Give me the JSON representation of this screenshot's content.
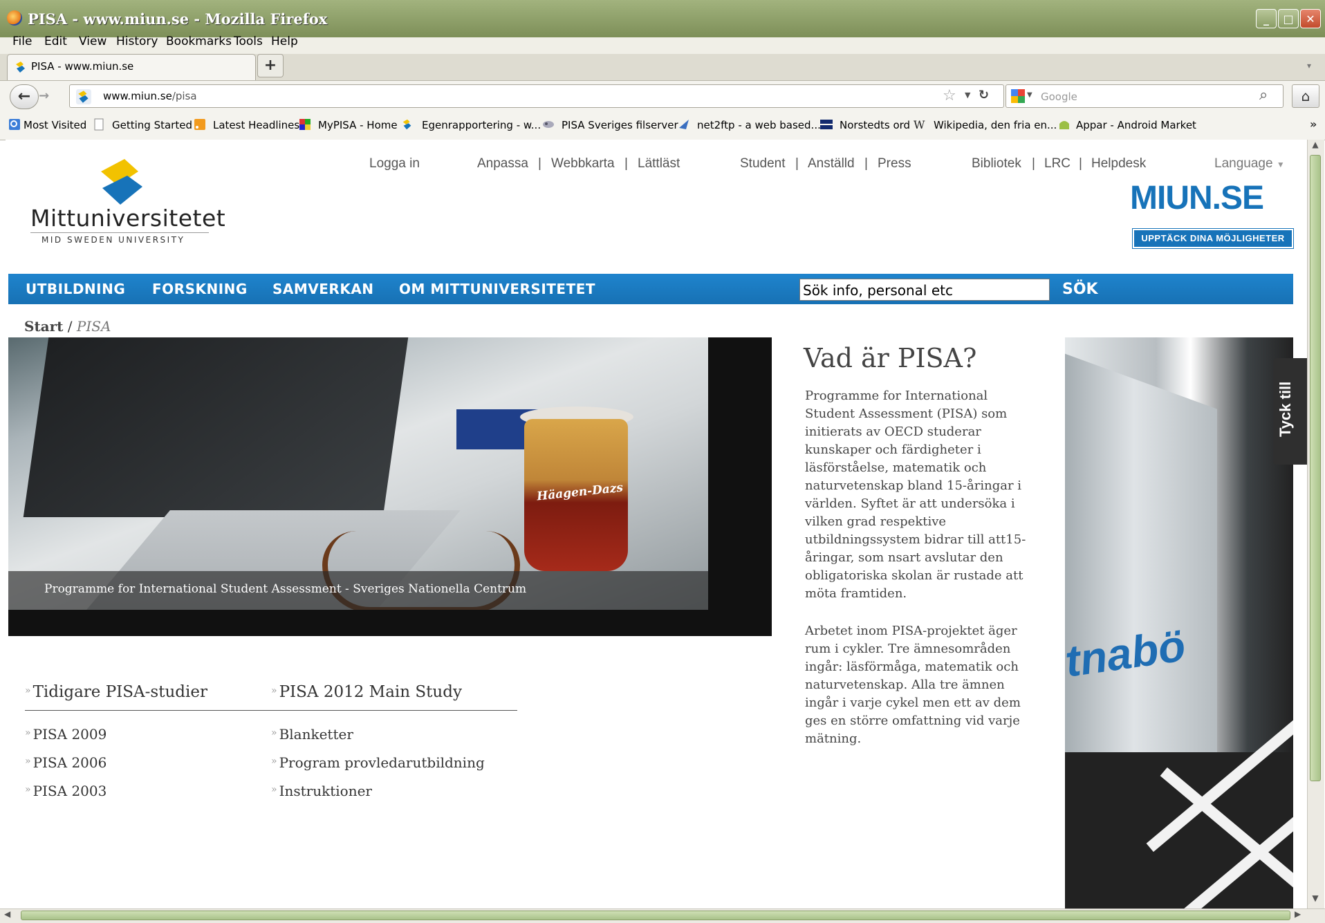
{
  "window": {
    "title": "PISA - www.miun.se - Mozilla Firefox",
    "minimize": "_",
    "maximize": "□",
    "close": "✕"
  },
  "menu": [
    "File",
    "Edit",
    "View",
    "History",
    "Bookmarks",
    "Tools",
    "Help"
  ],
  "tab": {
    "label": "PISA - www.miun.se",
    "new_tab": "+"
  },
  "url": {
    "host": "www.miun.se",
    "path": "/pisa"
  },
  "search": {
    "placeholder": "Google"
  },
  "bookmarks": [
    "Most Visited",
    "Getting Started",
    "Latest Headlines",
    "MyPISA - Home",
    "Egenrapportering - w...",
    "PISA Sveriges filserver",
    "net2ftp - a web based...",
    "Norstedts ord",
    "Wikipedia, den fria en...",
    "Appar - Android Market"
  ],
  "toplinks": {
    "login": "Logga in",
    "group1": [
      "Anpassa",
      "Webbkarta",
      "Lättläst"
    ],
    "group2": [
      "Student",
      "Anställd",
      "Press"
    ],
    "group3": [
      "Bibliotek",
      "LRC",
      "Helpdesk"
    ],
    "language": "Language"
  },
  "logo": {
    "name": "Mittuniversitetet",
    "sub": "MID SWEDEN UNIVERSITY"
  },
  "miun": {
    "title": "MIUN.SE",
    "tagline": "UPPTÄCK DINA MÖJLIGHETER"
  },
  "nav": [
    "UTBILDNING",
    "FORSKNING",
    "SAMVERKAN",
    "OM MITTUNIVERSITETET"
  ],
  "site_search": {
    "placeholder": "Sök info, personal etc",
    "button": "SÖK"
  },
  "breadcrumb": {
    "start": "Start",
    "sep": "/",
    "current": "PISA"
  },
  "hero": {
    "caption": "Programme for International Student Assessment - Sveriges Nationella Centrum",
    "cup_brand": "Häagen-Dazs"
  },
  "about": {
    "title": "Vad är PISA?",
    "p1": "Programme for International Student Assessment (PISA) som initierats av OECD studerar kunskaper och färdigheter i läsförståelse, matematik och naturvetenskap bland 15-åringar i världen. Syftet är att undersöka i vilken grad respektive utbildningssystem bidrar till att15-åringar, som nsart avslutar den obligatoriska skolan är rustade att möta framtiden.",
    "p2": "Arbetet inom PISA-projektet äger rum i cykler. Tre ämnesområden ingår: läsförmåga, matematik och naturvetenskap. Alla tre ämnen ingår i varje cykel men ett av dem ges en större omfattning vid varje mätning."
  },
  "feedback_tab": "Tyck till",
  "train_text": "tnabö",
  "lists": {
    "earlier": {
      "title": "Tidigare PISA-studier",
      "items": [
        "PISA 2009",
        "PISA 2006",
        "PISA 2003"
      ]
    },
    "main2012": {
      "title": "PISA 2012 Main Study",
      "items": [
        "Blanketter",
        "Program provledarutbildning",
        "Instruktioner"
      ]
    }
  }
}
